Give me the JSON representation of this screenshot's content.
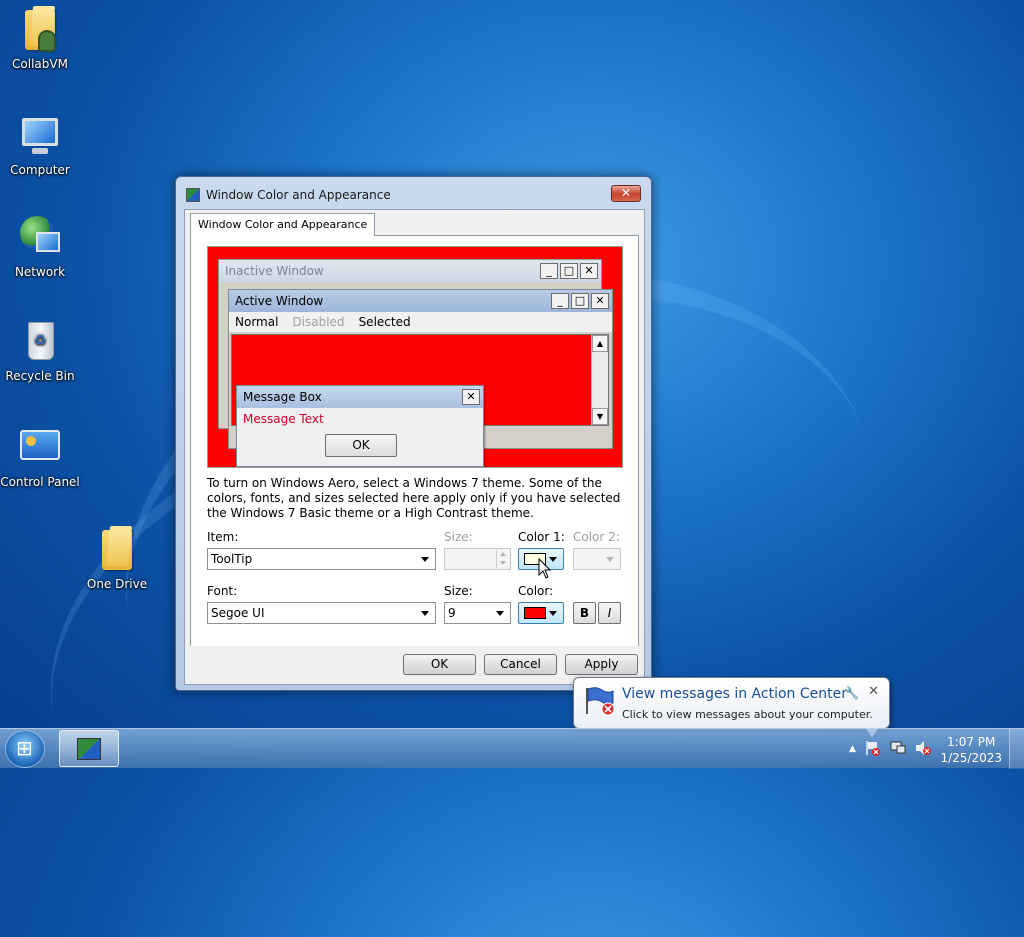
{
  "desktop": {
    "icons": [
      {
        "label": "CollabVM"
      },
      {
        "label": "Computer"
      },
      {
        "label": "Network"
      },
      {
        "label": "Recycle Bin"
      },
      {
        "label": "Control Panel"
      },
      {
        "label": "One Drive"
      }
    ]
  },
  "dialog": {
    "title": "Window Color and Appearance",
    "close_glyph": "✕",
    "tab_label": "Window Color and Appearance",
    "preview": {
      "inactive_title": "Inactive Window",
      "active_title": "Active Window",
      "menu_normal": "Normal",
      "menu_disabled": "Disabled",
      "menu_selected": "Selected",
      "msgbox_title": "Message Box",
      "msgbox_text": "Message Text",
      "msgbox_ok": "OK",
      "btn_min": "_",
      "btn_max": "□",
      "btn_close": "✕"
    },
    "description": "To turn on Windows Aero, select a Windows 7 theme.  Some of the colors, fonts, and sizes selected here apply only if you have selected the Windows 7 Basic theme or a High Contrast theme.",
    "item_label": "Item:",
    "item_value": "ToolTip",
    "item_size_label": "Size:",
    "item_size_value": "",
    "color1_label": "Color 1:",
    "color1_value": "#ffffe1",
    "color2_label": "Color 2:",
    "font_label": "Font:",
    "font_value": "Segoe UI",
    "font_size_label": "Size:",
    "font_size_value": "9",
    "font_color_label": "Color:",
    "font_color_value": "#ff0000",
    "bold_label": "B",
    "italic_label": "I",
    "ok_label": "OK",
    "cancel_label": "Cancel",
    "apply_label": "Apply"
  },
  "notification": {
    "title": "View messages in Action Center",
    "text": "Click to view messages about your computer.",
    "settings_glyph": "🔧",
    "close_glyph": "✕"
  },
  "taskbar": {
    "time": "1:07 PM",
    "date": "1/25/2023"
  },
  "colors": {
    "preview_background": "#ff0000",
    "message_text": "#d0002a",
    "balloon_title": "#1a4e96"
  }
}
